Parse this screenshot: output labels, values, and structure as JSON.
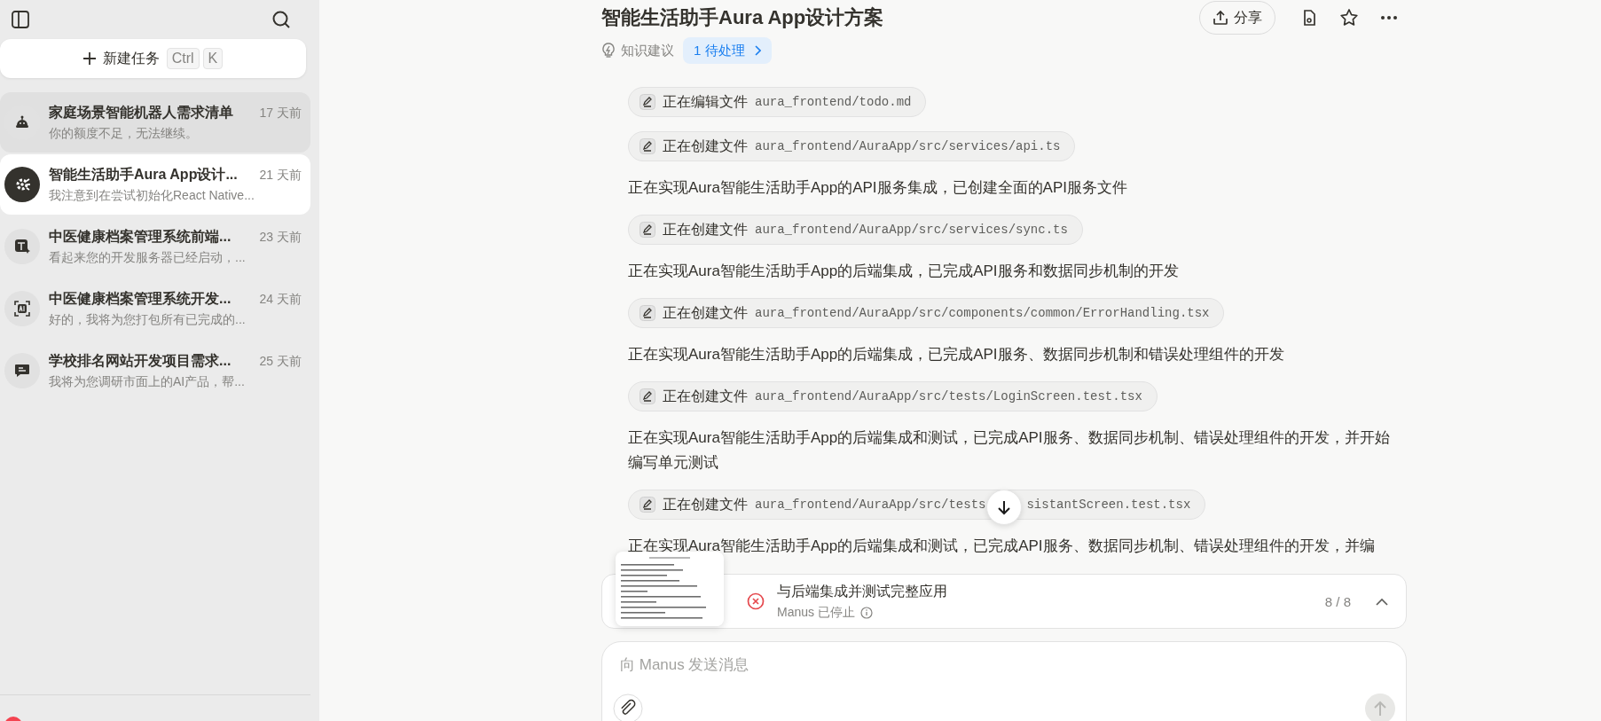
{
  "sidebar": {
    "new_task": {
      "label": "新建任务",
      "keys": [
        "Ctrl",
        "K"
      ]
    },
    "tasks": [
      {
        "kind": "robot",
        "title": "家庭场景智能机器人需求清单",
        "time": "17 天前",
        "preview": "你的额度不足，无法继续。",
        "selected": false,
        "hovered": true
      },
      {
        "kind": "gear",
        "title": "智能生活助手Aura App设计...",
        "time": "21 天前",
        "preview": "我注意到在尝试初始化React Native...",
        "selected": true,
        "hovered": false
      },
      {
        "kind": "text",
        "title": "中医健康档案管理系统前端...",
        "time": "23 天前",
        "preview": "看起来您的开发服务器已经启动，...",
        "selected": false,
        "hovered": false
      },
      {
        "kind": "ai",
        "title": "中医健康档案管理系统开发...",
        "time": "24 天前",
        "preview": "好的，我将为您打包所有已完成的...",
        "selected": false,
        "hovered": false
      },
      {
        "kind": "chat",
        "title": "学校排名网站开发项目需求...",
        "time": "25 天前",
        "preview": "我将为您调研市面上的AI产品，帮...",
        "selected": false,
        "hovered": false
      }
    ]
  },
  "header": {
    "title": "智能生活助手Aura App设计方案",
    "share": "分享",
    "knowledge": "知识建议",
    "pending": "1 待处理"
  },
  "log": [
    {
      "kind": "file",
      "action": "正在编辑文件",
      "path": "aura_frontend/todo.md"
    },
    {
      "kind": "file",
      "action": "正在创建文件",
      "path": "aura_frontend/AuraApp/src/services/api.ts"
    },
    {
      "kind": "message",
      "text": "正在实现Aura智能生活助手App的API服务集成，已创建全面的API服务文件"
    },
    {
      "kind": "file",
      "action": "正在创建文件",
      "path": "aura_frontend/AuraApp/src/services/sync.ts"
    },
    {
      "kind": "message",
      "text": "正在实现Aura智能生活助手App的后端集成，已完成API服务和数据同步机制的开发"
    },
    {
      "kind": "file",
      "action": "正在创建文件",
      "path": "aura_frontend/AuraApp/src/components/common/ErrorHandling.tsx"
    },
    {
      "kind": "message",
      "text": "正在实现Aura智能生活助手App的后端集成，已完成API服务、数据同步机制和错误处理组件的开发"
    },
    {
      "kind": "file",
      "action": "正在创建文件",
      "path": "aura_frontend/AuraApp/src/tests/LoginScreen.test.tsx"
    },
    {
      "kind": "message",
      "text": "正在实现Aura智能生活助手App的后端集成和测试，已完成API服务、数据同步机制、错误处理组件的开发，并开始编写单元测试"
    },
    {
      "kind": "file",
      "action": "正在创建文件",
      "path_parts": [
        "aura_frontend/AuraApp/src/tests",
        "sistantScreen.test.tsx"
      ]
    },
    {
      "kind": "message",
      "text": "正在实现Aura智能生活助手App的后端集成和测试，已完成API服务、数据同步机制、错误处理组件的开发，并编"
    }
  ],
  "task_bar": {
    "stopped": true,
    "title": "与后端集成并测试完整应用",
    "subtitle": "Manus 已停止",
    "progress": "8 / 8"
  },
  "composer": {
    "placeholder": "向 Manus 发送消息"
  }
}
